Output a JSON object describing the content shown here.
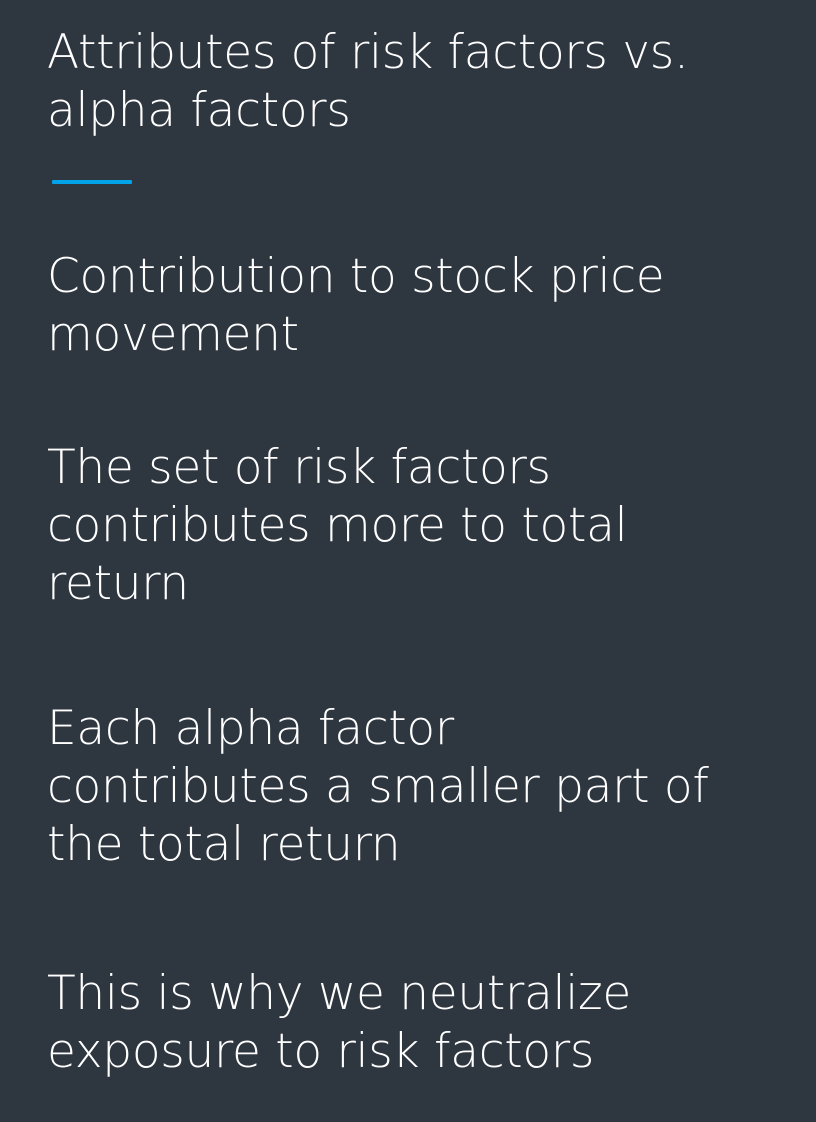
{
  "slide": {
    "title_lines": [
      "Attributes of risk factors vs.",
      "alpha factors"
    ],
    "accent_color": "#02a3e8",
    "background_color": "#2e3640",
    "paragraphs": [
      {
        "lines": [
          "Contribution to stock price",
          "movement"
        ]
      },
      {
        "lines": [
          "The set of risk factors",
          "contributes more to total",
          "return"
        ]
      },
      {
        "lines": [
          "Each alpha factor",
          "contributes a smaller part of",
          "the total return"
        ]
      },
      {
        "lines": [
          "This is why we neutralize",
          "exposure to risk factors"
        ]
      }
    ]
  }
}
